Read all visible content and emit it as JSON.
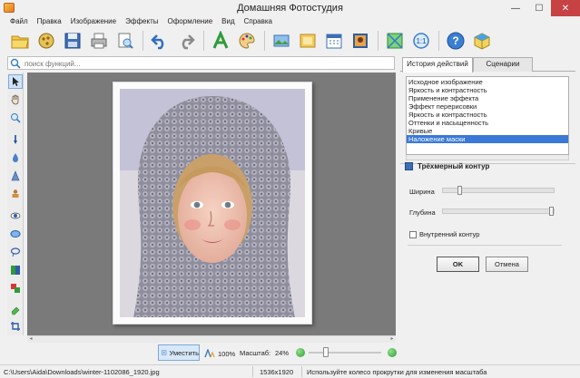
{
  "window": {
    "title": "Домашняя Фотостудия",
    "minimize_glyph": "—",
    "maximize_glyph": "☐",
    "close_glyph": "✕"
  },
  "menu": [
    "Файл",
    "Правка",
    "Изображение",
    "Эффекты",
    "Оформление",
    "Вид",
    "Справка"
  ],
  "toolbar": {
    "buttons": [
      "open-folder-icon",
      "gallery-icon",
      "save-icon",
      "print-icon",
      "preview-icon",
      "undo-icon",
      "redo-icon",
      "text-icon",
      "palette-icon",
      "frame-icon",
      "image-icon",
      "calendar-icon",
      "collage-icon",
      "crop-icon",
      "actual-size-icon",
      "help-icon",
      "package-icon"
    ]
  },
  "search": {
    "placeholder": "поиск функций...",
    "value": ""
  },
  "left_tools": [
    "pointer-icon",
    "hand-icon",
    "zoom-icon",
    "brush-icon",
    "drop-icon",
    "sharpen-icon",
    "stamp-icon",
    "red-eye-icon",
    "ellipse-icon",
    "lasso-icon",
    "color-icon",
    "replace-icon",
    "eraser-icon",
    "crop-tool-icon"
  ],
  "right_panel": {
    "tabs": [
      "История действий",
      "Сценарии"
    ],
    "active_tab": 0,
    "history": [
      "Исходное изображение",
      "Яркость и контрастность",
      "Применение эффекта",
      "Эффект перерисовки",
      "Яркость и контрастность",
      "Оттенки и насыщенность",
      "Кривые",
      "Наложение маски"
    ],
    "selected_history": 7,
    "effect_title": "Трёхмерный контур",
    "params": [
      {
        "label": "Ширина",
        "level": 0.14
      },
      {
        "label": "Глубина",
        "level": 1.0
      }
    ],
    "checkbox_label": "Внутренний контур",
    "checkbox_checked": false,
    "ok_label": "OK",
    "cancel_label": "Отмена"
  },
  "bottom": {
    "fit_label": "Уместить",
    "zoom_100": "100%",
    "scale_label": "Масштаб:",
    "scale_value": "24%",
    "zoom_level": 0.24
  },
  "status": {
    "path": "C:\\Users\\Aida\\Downloads\\winter-1102086_1920.jpg",
    "size": "1536x1920",
    "hint": "Используйте колесо прокрутки для изменения масштаба"
  },
  "colors": {
    "accent": "#3a79d6",
    "close": "#c74343",
    "canvas": "#7a7a7a"
  }
}
